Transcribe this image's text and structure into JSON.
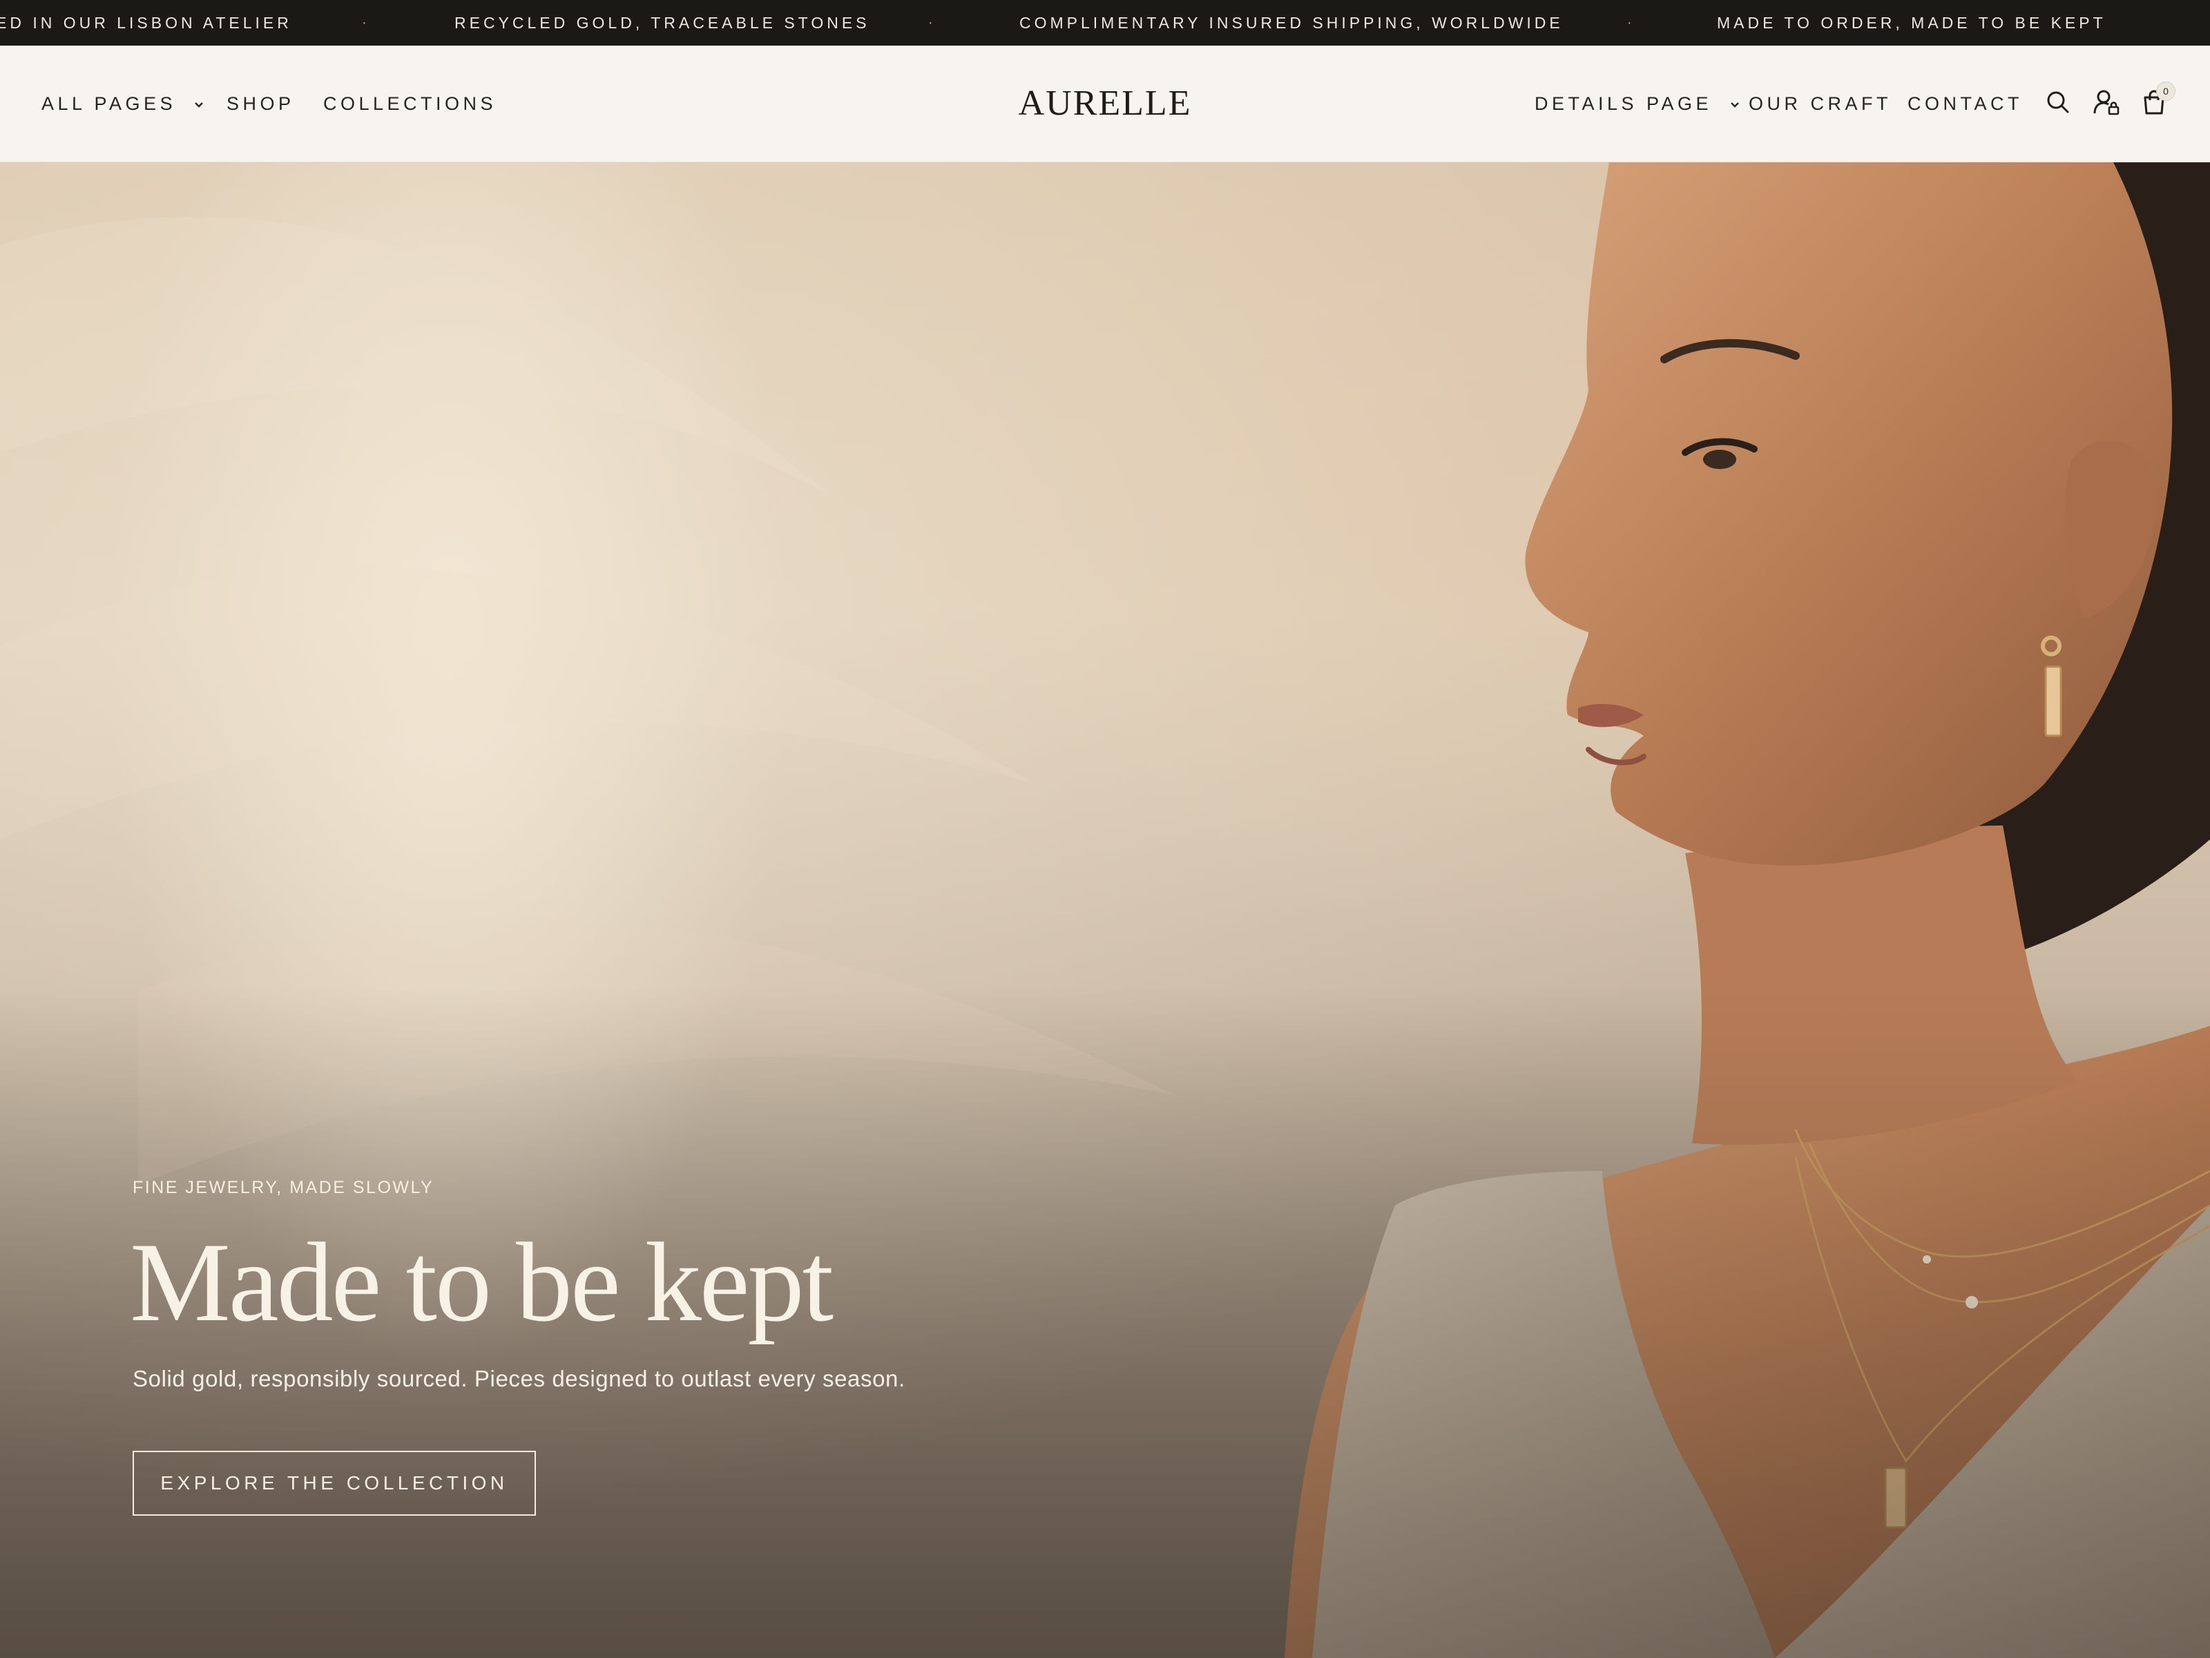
{
  "announcement": {
    "messages": [
      "ED IN OUR LISBON ATELIER",
      "RECYCLED GOLD, TRACEABLE STONES",
      "COMPLIMENTARY INSURED SHIPPING, WORLDWIDE",
      "MADE TO ORDER, MADE TO BE KEPT"
    ],
    "separator": "·"
  },
  "header": {
    "logo": "AURELLE",
    "nav_left": [
      {
        "label": "ALL PAGES",
        "has_dropdown": true
      },
      {
        "label": "SHOP",
        "has_dropdown": false
      },
      {
        "label": "COLLECTIONS",
        "has_dropdown": false
      }
    ],
    "nav_right": [
      {
        "label": "DETAILS PAGE",
        "has_dropdown": true
      },
      {
        "label": "OUR CRAFT",
        "has_dropdown": false
      },
      {
        "label": "CONTACT",
        "has_dropdown": false
      }
    ],
    "icons": [
      "search-icon",
      "account-icon",
      "cart-icon"
    ],
    "cart_count": "0"
  },
  "hero": {
    "eyebrow": "FINE JEWELRY, MADE SLOWLY",
    "title": "Made to be kept",
    "subtitle": "Solid gold, responsibly sourced. Pieces designed to outlast every season.",
    "cta_label": "EXPLORE THE COLLECTION"
  },
  "colors": {
    "announcement_bg": "#1b1916",
    "header_bg": "#f7f4ef",
    "text_dark": "#27231f",
    "hero_text": "#f6efe5"
  }
}
